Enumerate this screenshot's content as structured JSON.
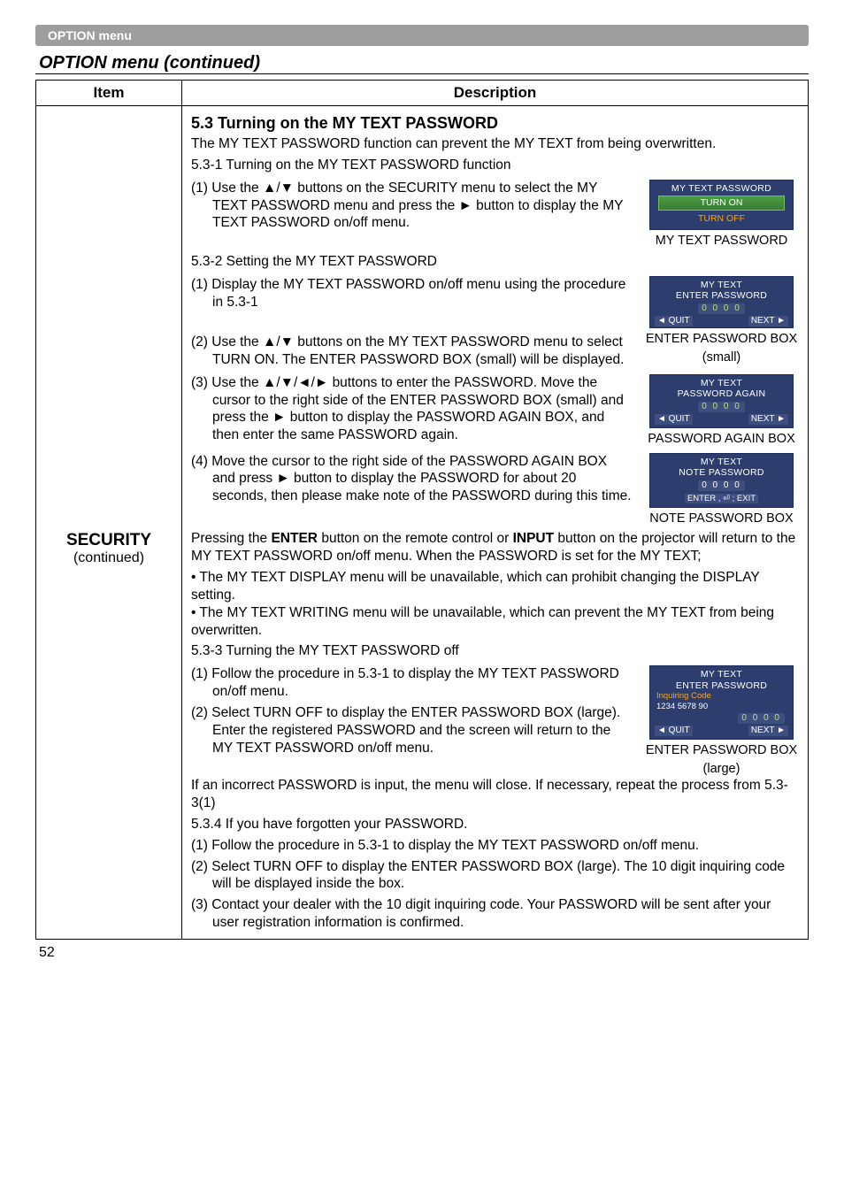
{
  "header_bar": "OPTION menu",
  "section_title": "OPTION menu (continued)",
  "table": {
    "head_item": "Item",
    "head_description": "Description",
    "item_label_bold": "SECURITY",
    "item_label_sub": "(continued)"
  },
  "desc_title": "5.3 Turning on the MY TEXT PASSWORD",
  "desc_title_sub": "The MY TEXT PASSWORD function can prevent the MY TEXT from being overwritten.",
  "p_5_3_1_h": "5.3-1 Turning on the MY TEXT PASSWORD function",
  "p_5_3_1_1": "(1) Use the ▲/▼ buttons on the SECURITY menu to select the MY TEXT PASSWORD menu and press the ► button to display the MY TEXT PASSWORD on/off menu.",
  "p_5_3_2_h": "5.3-2 Setting the MY TEXT PASSWORD",
  "p_5_3_2_1": "(1) Display the MY TEXT PASSWORD on/off menu using the procedure in 5.3-1",
  "p_5_3_2_2": "(2) Use the ▲/▼ buttons on the MY TEXT PASSWORD menu to select TURN ON. The ENTER PASSWORD BOX (small) will be displayed.",
  "p_5_3_2_3": "(3) Use the ▲/▼/◄/► buttons to enter the PASSWORD. Move the cursor to the right side of the ENTER PASSWORD BOX (small) and press the ► button to display the PASSWORD AGAIN BOX, and then enter the same PASSWORD again.",
  "p_5_3_2_4": "(4) Move the cursor to the right side of the PASSWORD AGAIN BOX and press ► button to display the PASSWORD for about 20 seconds, then please make note of the PASSWORD during this time.",
  "p_post_4_a": "Pressing the ",
  "p_post_4_enter": "ENTER",
  "p_post_4_b": " button on the remote control or ",
  "p_post_4_input": "INPUT",
  "p_post_4_c": " button on the projector will return to the MY TEXT PASSWORD on/off menu. When the PASSWORD is set for the MY TEXT;",
  "bullet1": "• The MY TEXT DISPLAY menu will be unavailable, which can prohibit changing the DISPLAY setting.",
  "bullet2": "• The MY TEXT WRITING menu will be unavailable, which can prevent the MY TEXT from being overwritten.",
  "p_5_3_3_h": "5.3-3 Turning the MY TEXT PASSWORD off",
  "p_5_3_3_1": "(1) Follow the procedure in 5.3-1 to display the MY TEXT PASSWORD on/off menu.",
  "p_5_3_3_2": "(2) Select TURN OFF to display the ENTER PASSWORD BOX (large). Enter the registered PASSWORD and the screen will return to the MY TEXT PASSWORD on/off menu.",
  "p_5_3_3_after": "If an incorrect PASSWORD is input, the menu will close. If necessary, repeat the process from 5.3-3(1)",
  "p_5_3_4_h": "5.3.4 If you have forgotten your PASSWORD.",
  "p_5_3_4_1": "(1) Follow the procedure in 5.3-1 to display the MY TEXT PASSWORD on/off menu.",
  "p_5_3_4_2": "(2) Select TURN OFF to display the ENTER PASSWORD BOX (large). The 10 digit inquiring code will be displayed inside the box.",
  "p_5_3_4_3": "(3) Contact your dealer with the 10 digit inquiring code. Your PASSWORD will be sent after your user registration information is confirmed.",
  "figs": {
    "fig1": {
      "title": "MY TEXT PASSWORD",
      "on": "TURN ON",
      "off": "TURN OFF",
      "caption": "MY TEXT PASSWORD"
    },
    "fig2": {
      "t1": "MY TEXT",
      "t2": "ENTER PASSWORD",
      "digits": "0 0 0 0",
      "quit": "◄ QUIT",
      "next": "NEXT ►",
      "caption1": "ENTER PASSWORD BOX",
      "caption2": "(small)"
    },
    "fig3": {
      "t1": "MY TEXT",
      "t2": "PASSWORD AGAIN",
      "digits": "0 0 0 0",
      "quit": "◄ QUIT",
      "next": "NEXT ►",
      "caption": "PASSWORD AGAIN BOX"
    },
    "fig4": {
      "t1": "MY TEXT",
      "t2": "NOTE PASSWORD",
      "digits": "0 0 0 0",
      "enter": "ENTER , ⏎ ; EXIT",
      "caption": "NOTE PASSWORD BOX"
    },
    "fig5": {
      "t1": "MY TEXT",
      "t2": "ENTER PASSWORD",
      "inq1": "Inquiring Code",
      "inq2": "1234 5678 90",
      "digits": "0 0 0 0",
      "quit": "◄ QUIT",
      "next": "NEXT ►",
      "caption1": "ENTER PASSWORD BOX",
      "caption2": "(large)"
    }
  },
  "page_number": "52"
}
